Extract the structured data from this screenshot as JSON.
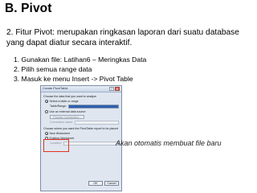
{
  "slide": {
    "title": "B. Pivot",
    "intro": "2. Fitur Pivot: merupakan ringkasan laporan dari suatu database yang dapat diatur secara interaktif.",
    "steps": [
      "1. Gunakan file: Latihan6 – Meringkas Data",
      "2. Pilih semua range data",
      "3. Masuk ke menu Insert -> Pivot Table"
    ],
    "caption": "Akan otomatis membuat file baru"
  },
  "dialog": {
    "title": "Create PivotTable",
    "close_glyph": "✕",
    "help_glyph": "?",
    "choose_data_label": "Choose the data that you want to analyze",
    "select_table_option": "Select a table or range",
    "table_range_label": "Table/Range:",
    "external_option": "Use an external data source",
    "choose_connection_button": "Choose Connection...",
    "connection_name_label": "Connection name:",
    "placement_label": "Choose where you want the PivotTable report to be placed",
    "new_worksheet_option": "New Worksheet",
    "existing_worksheet_option": "Existing Worksheet",
    "location_label": "Location:",
    "ok_button": "OK",
    "cancel_button": "Cancel"
  }
}
